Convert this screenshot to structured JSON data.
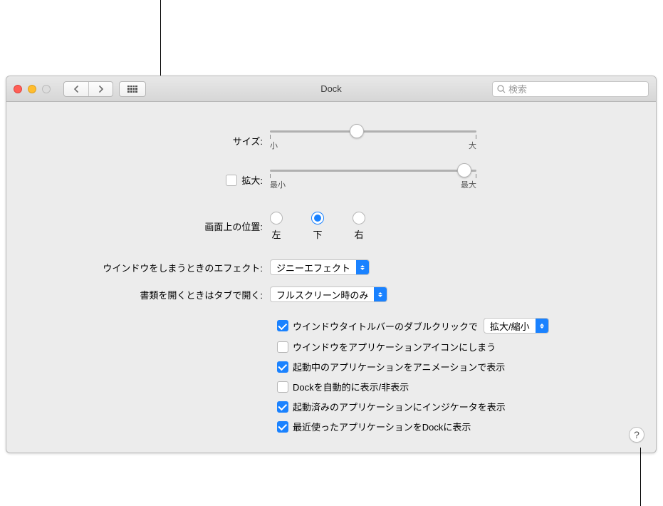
{
  "window": {
    "title": "Dock",
    "search_placeholder": "検索"
  },
  "size": {
    "label": "サイズ:",
    "min": "小",
    "max": "大",
    "pos_pct": 42
  },
  "magnify": {
    "label": "拡大:",
    "min": "最小",
    "max": "最大",
    "checked": false,
    "pos_pct": 94
  },
  "position": {
    "label": "画面上の位置:",
    "options": [
      "左",
      "下",
      "右"
    ],
    "selected_index": 1
  },
  "minimize_effect": {
    "label": "ウインドウをしまうときのエフェクト:",
    "value": "ジニーエフェクト"
  },
  "tabs": {
    "label": "書類を開くときはタブで開く:",
    "value": "フルスクリーン時のみ"
  },
  "checks": {
    "dbl_click": {
      "checked": true,
      "label": "ウインドウタイトルバーのダブルクリックで",
      "select": "拡大/縮小"
    },
    "min_to_app": {
      "checked": false,
      "label": "ウインドウをアプリケーションアイコンにしまう"
    },
    "animate": {
      "checked": true,
      "label": "起動中のアプリケーションをアニメーションで表示"
    },
    "autohide": {
      "checked": false,
      "label": "Dockを自動的に表示/非表示"
    },
    "indicators": {
      "checked": true,
      "label": "起動済みのアプリケーションにインジケータを表示"
    },
    "recent": {
      "checked": true,
      "label": "最近使ったアプリケーションをDockに表示"
    }
  },
  "help": "?"
}
